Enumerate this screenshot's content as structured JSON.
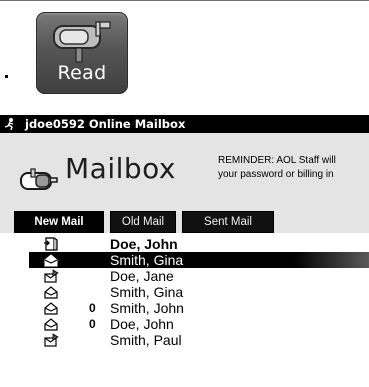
{
  "toolbar": {
    "read_button": {
      "label": "Read",
      "icon": "mailbox-icon"
    }
  },
  "window": {
    "title": "jdoe0592  Online Mailbox",
    "title_icon": "aol-runner-icon"
  },
  "mailbox": {
    "title": "Mailbox",
    "icon": "mailbox-icon",
    "reminder_line1": "REMINDER: AOL Staff will",
    "reminder_line2": "your password or billing in"
  },
  "tabs": [
    {
      "label": "New Mail",
      "active": true
    },
    {
      "label": "Old Mail",
      "active": false
    },
    {
      "label": "Sent Mail",
      "active": false
    }
  ],
  "messages": [
    {
      "sender": "Doe, John",
      "icon": "open-door-icon",
      "attachment": false,
      "bold": true,
      "selected": false
    },
    {
      "sender": "Smith, Gina",
      "icon": "envelope-icon",
      "attachment": false,
      "bold": false,
      "selected": true
    },
    {
      "sender": "Doe, Jane",
      "icon": "reply-envelope-icon",
      "attachment": false,
      "bold": false,
      "selected": false
    },
    {
      "sender": "Smith, Gina",
      "icon": "envelope-icon",
      "attachment": false,
      "bold": false,
      "selected": false
    },
    {
      "sender": "Smith, John",
      "icon": "envelope-icon",
      "attachment": true,
      "bold": false,
      "selected": false
    },
    {
      "sender": "Doe, John",
      "icon": "envelope-icon",
      "attachment": true,
      "bold": false,
      "selected": false
    },
    {
      "sender": "Smith, Paul",
      "icon": "reply-envelope-icon",
      "attachment": false,
      "bold": false,
      "selected": false
    }
  ],
  "attachment_glyph": "0",
  "colors": {
    "titlebar": "#000000",
    "selected_row": "#000000",
    "window_bg": "#e4e4e4"
  }
}
